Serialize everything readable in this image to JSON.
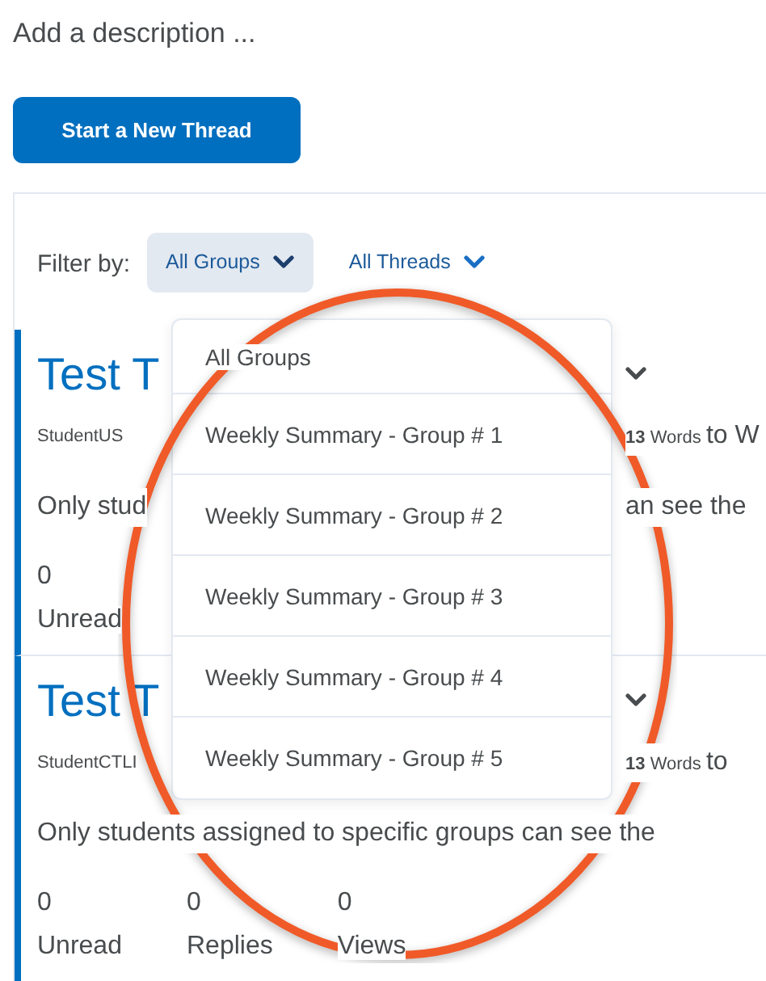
{
  "description": "Add a description ...",
  "new_thread_button": "Start a New Thread",
  "filter": {
    "label": "Filter by:",
    "groups": {
      "label": "All Groups",
      "expanded": true
    },
    "threads": {
      "label": "All Threads",
      "expanded": false
    }
  },
  "group_menu": [
    {
      "label": "All Groups"
    },
    {
      "label": "Weekly Summary - Group # 1"
    },
    {
      "label": "Weekly Summary - Group # 2"
    },
    {
      "label": "Weekly Summary - Group # 3"
    },
    {
      "label": "Weekly Summary - Group # 4"
    },
    {
      "label": "Weekly Summary - Group # 5"
    }
  ],
  "threads": [
    {
      "title": "Test T",
      "author": "StudentUS",
      "word_count": "13",
      "words": "Words",
      "to": "to W",
      "body": "Only stud",
      "body_end": "an see the",
      "stats": [
        {
          "value": "0",
          "label": "Unread"
        }
      ]
    },
    {
      "title": "Test T",
      "author": "StudentCTLI",
      "word_count": "13",
      "words": "Words",
      "to": "to",
      "body": "Only students assigned to specific groups can see the",
      "stats": [
        {
          "value": "0",
          "label": "Unread"
        },
        {
          "value": "0",
          "label": "Replies"
        },
        {
          "value": "0",
          "label": "Views"
        }
      ]
    }
  ]
}
